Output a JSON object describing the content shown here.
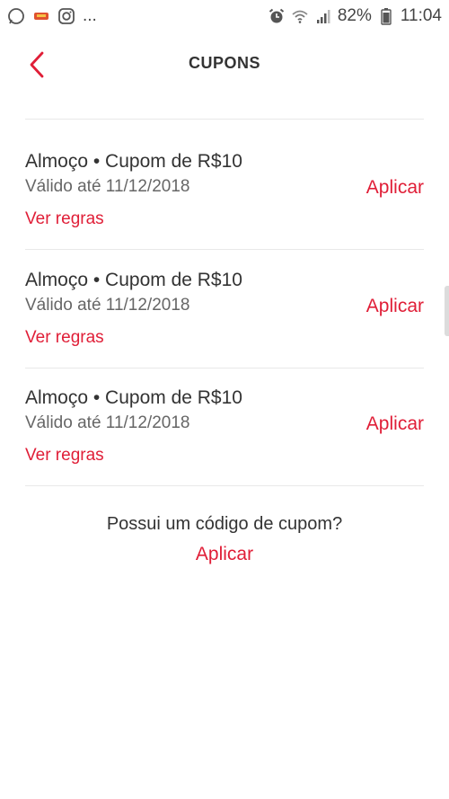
{
  "status_bar": {
    "notification_icons": [
      "whatsapp-icon",
      "app-notification-icon",
      "instagram-icon"
    ],
    "more": "...",
    "battery": "82%",
    "time": "11:04"
  },
  "header": {
    "title": "CUPONS",
    "back_icon": "chevron-left-icon"
  },
  "coupons": [
    {
      "title": "Almoço • Cupom de R$10",
      "validity": "Válido até 11/12/2018",
      "apply_label": "Aplicar",
      "rules_label": "Ver regras"
    },
    {
      "title": "Almoço • Cupom de R$10",
      "validity": "Válido até 11/12/2018",
      "apply_label": "Aplicar",
      "rules_label": "Ver regras"
    },
    {
      "title": "Almoço • Cupom de R$10",
      "validity": "Válido até 11/12/2018",
      "apply_label": "Aplicar",
      "rules_label": "Ver regras"
    }
  ],
  "code_section": {
    "question": "Possui um código de cupom?",
    "apply_label": "Aplicar"
  },
  "colors": {
    "accent": "#e01e37",
    "text": "#333333",
    "muted": "#666666",
    "divider": "#e8e8e8"
  }
}
